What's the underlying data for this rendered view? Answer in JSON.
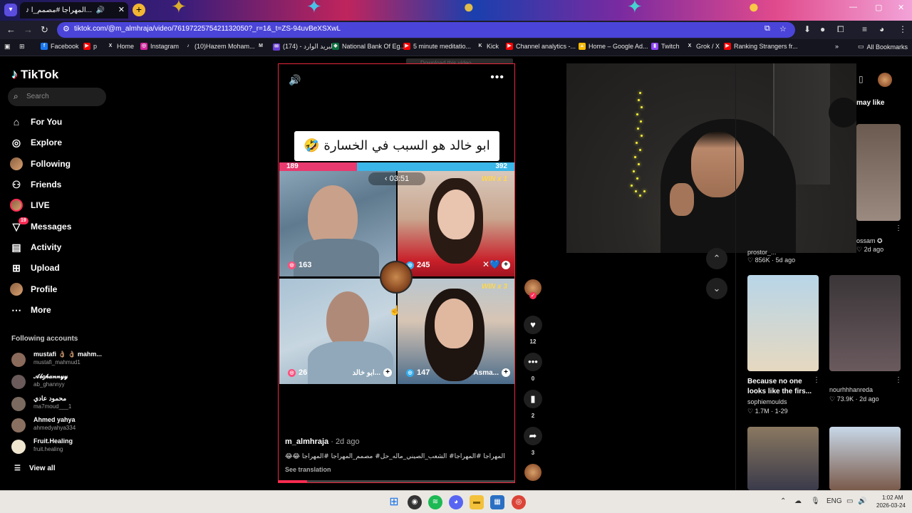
{
  "browser": {
    "tab_title": "المهراجا #مصمم_ا...",
    "url": "tiktok.com/@m_almhraja/video/7619722575421132050?_r=1&_t=ZS-94uvBeXSXwL",
    "all_bookmarks": "All Bookmarks",
    "bookmarks": [
      {
        "label": "Facebook",
        "icon": "facebook-icon",
        "color": "#1877f2",
        "glyph": "f"
      },
      {
        "label": "p",
        "icon": "youtube-icon",
        "color": "#ff0000",
        "glyph": "▶"
      },
      {
        "label": "Home",
        "icon": "x-icon",
        "color": "#15151f",
        "glyph": "X"
      },
      {
        "label": "Instagram",
        "icon": "instagram-icon",
        "color": "#d6249f",
        "glyph": "◎"
      },
      {
        "label": "(10)Hazem Moham...",
        "icon": "tiktok-icon",
        "color": "#15151f",
        "glyph": "♪"
      },
      {
        "label": "",
        "icon": "gmail-icon",
        "color": "#15151f",
        "glyph": "M"
      },
      {
        "label": "(174) - البريد الوارد",
        "icon": "mail-icon",
        "color": "#6b3fd9",
        "glyph": "✉"
      },
      {
        "label": "National Bank Of Eg...",
        "icon": "bank-icon",
        "color": "#0a6e3d",
        "glyph": "◆"
      },
      {
        "label": "5 minute meditatio...",
        "icon": "youtube-icon",
        "color": "#ff0000",
        "glyph": "▶"
      },
      {
        "label": "Kick",
        "icon": "kick-icon",
        "color": "#15151f",
        "glyph": "K"
      },
      {
        "label": "Channel analytics -...",
        "icon": "youtube-icon",
        "color": "#ff0000",
        "glyph": "▶"
      },
      {
        "label": "Home – Google Ad...",
        "icon": "google-ads-icon",
        "color": "#fbbc04",
        "glyph": "▲"
      },
      {
        "label": "Twitch",
        "icon": "twitch-icon",
        "color": "#9146ff",
        "glyph": "▮"
      },
      {
        "label": "Grok / X",
        "icon": "x-icon",
        "color": "#15151f",
        "glyph": "X"
      },
      {
        "label": "Ranking Strangers fr...",
        "icon": "youtube-icon",
        "color": "#ff0000",
        "glyph": "▶"
      }
    ]
  },
  "sidebar": {
    "brand": "TikTok",
    "search_placeholder": "Search",
    "nav": [
      {
        "label": "For You",
        "icon": "home-icon",
        "glyph": "⌂"
      },
      {
        "label": "Explore",
        "icon": "compass-icon",
        "glyph": "◎"
      },
      {
        "label": "Following",
        "icon": "following-avatar",
        "glyph": ""
      },
      {
        "label": "Friends",
        "icon": "friends-icon",
        "glyph": "⚇"
      },
      {
        "label": "LIVE",
        "icon": "live-avatar",
        "glyph": ""
      },
      {
        "label": "Messages",
        "icon": "messages-icon",
        "glyph": "▽",
        "badge": "19"
      },
      {
        "label": "Activity",
        "icon": "activity-icon",
        "glyph": "▤"
      },
      {
        "label": "Upload",
        "icon": "upload-icon",
        "glyph": "⊞"
      },
      {
        "label": "Profile",
        "icon": "profile-avatar",
        "glyph": ""
      },
      {
        "label": "More",
        "icon": "more-icon",
        "glyph": "⋯"
      }
    ],
    "following_title": "Following accounts",
    "accounts": [
      {
        "name": "mustafi 👌🏽 👌🏽 mahm...",
        "handle": "mustafi_mahmud1",
        "color": "#8a6a5a"
      },
      {
        "name": "𝒜𝒷𝑔𝒽𝒶𝓃𝓃𝓎𝓎",
        "handle": "ab_ghannyy",
        "color": "#6a5a5a"
      },
      {
        "name": "محمود عادي",
        "handle": "ma7moud___1",
        "color": "#7a6a5f"
      },
      {
        "name": "Ahmed yahya",
        "handle": "ahmedyahya334",
        "color": "#8a7060"
      },
      {
        "name": "Fruit.Healing",
        "handle": "fruit.healing",
        "color": "#f0e6d0"
      }
    ],
    "view_all": "View all"
  },
  "video": {
    "download_bar": "Download this video",
    "caption": "ابو خالد هو السبب في الخسارة 🤣",
    "score_left": "189",
    "score_right": "392",
    "timer": "03:51",
    "tiles": [
      {
        "score": "163",
        "name": "",
        "win": ""
      },
      {
        "score": "245",
        "name": "",
        "win": "WIN x 1"
      },
      {
        "score": "26",
        "name": "ابو خالد...",
        "win": ""
      },
      {
        "score": "147",
        "name": "Asma...",
        "win": "WIN x 3"
      }
    ],
    "username": "m_almhraja",
    "date": "· 2d ago",
    "description": "المهراجا #المهراجا# الشعب_الصيني_ماله_حل# مصمم_المهراجا #المهراجا 😂😂",
    "see_translation": "See translation",
    "progress": 0.12
  },
  "actions": {
    "likes": "12",
    "comments": "0",
    "saves": "2",
    "shares": "3"
  },
  "right": {
    "title": "may like",
    "videos": [
      {
        "caption": "",
        "user": "prostor_...",
        "likes": "856K · 5d ago",
        "color1": "#3a3a3a",
        "color2": "#555"
      },
      {
        "caption": "",
        "user": "ossam ✪",
        "likes": "2d ago",
        "color1": "#6a5a50",
        "color2": "#9a8a80"
      },
      {
        "caption": "Because no one looks like the firs...",
        "user": "sophiemoulds",
        "likes": "1.7M · 1-29",
        "color1": "#b8d6e8",
        "color2": "#e6d8c0"
      },
      {
        "caption": "",
        "user": "nourhhhanreda",
        "likes": "73.9K · 2d ago",
        "color1": "#3a3538",
        "color2": "#6a5a5e"
      },
      {
        "caption": "",
        "user": "",
        "likes": "",
        "color1": "#8a7860",
        "color2": "#3a3a4a"
      },
      {
        "caption": "",
        "user": "",
        "likes": "",
        "color1": "#c8d8e8",
        "color2": "#7a5a4a"
      }
    ]
  },
  "taskbar": {
    "lang": "ENG",
    "time": "1:02 AM",
    "date": "2026-03-24"
  }
}
